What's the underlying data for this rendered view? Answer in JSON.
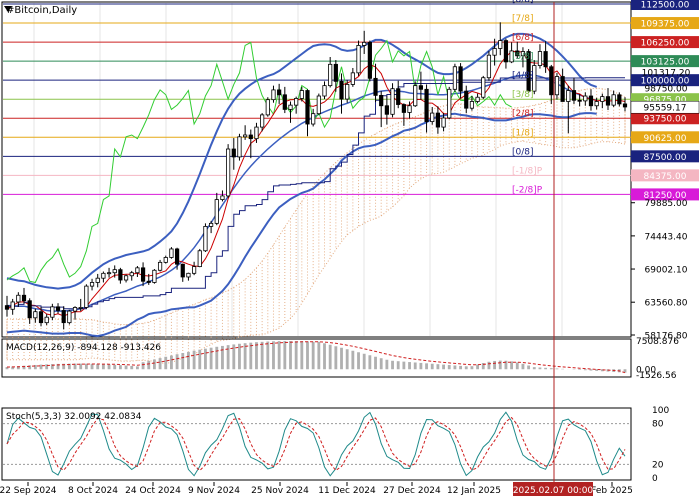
{
  "window": {
    "symbol_label": "#Bitcoin,Daily",
    "macd_label": "MACD(12,26,9) -894.128 -913.426",
    "stoch_label": "Stoch(5,3,3) 32.0092 42.0834",
    "crosshair_date": "2025.02.07 00:00"
  },
  "colors": {
    "bg": "#ffffff",
    "grid": "#e6e6e6",
    "candle": "#000000",
    "bollinger": "#3c5fc0",
    "green_line": "#32cd32",
    "red_line": "#cc0000",
    "navy_line": "#1a237e",
    "cloud": "#e0a070",
    "vertical_line": "#b22222",
    "macd_hist": "#b0b0b0",
    "macd_signal": "#d02020",
    "stoch_main": "#1f8a8a",
    "stoch_signal": "#d02020"
  },
  "chart_data": [
    {
      "type": "candlestick",
      "symbol": "#Bitcoin",
      "timeframe": "Daily",
      "x_labels": [
        "22 Sep 2024",
        "8 Oct 2024",
        "24 Oct 2024",
        "9 Nov 2024",
        "25 Nov 2024",
        "11 Dec 2024",
        "27 Dec 2024",
        "12 Jan 2025",
        "Feb 2025"
      ],
      "ylim": [
        58176.8,
        112500
      ],
      "price_ticks": [
        "58176.80",
        "63560.80",
        "69002.10",
        "74443.40",
        "79885.00"
      ],
      "current_price": "95559.17",
      "murray_levels": [
        {
          "label": "[8/8]",
          "price": "112500.00",
          "color": "#1a237e",
          "box": true
        },
        {
          "label": "[7/8]",
          "price": "109375.00",
          "color": "#e6a817",
          "box": true
        },
        {
          "label": "[6/8]",
          "price": "106250.00",
          "color": "#cc2222",
          "box": true
        },
        {
          "label": "[5/8]",
          "price": "103125.00",
          "color": "#2e8b57",
          "box": true
        },
        {
          "label": "[4/8]",
          "price": "100000.00",
          "color": "#1a237e",
          "box": true
        },
        {
          "label": "[3/8]",
          "price": "96875.00",
          "color": "#8bc34a",
          "box": true
        },
        {
          "label": "[2/8]",
          "price": "93750.00",
          "color": "#cc2222",
          "box": true
        },
        {
          "label": "[1/8]",
          "price": "90625.00",
          "color": "#e6a817",
          "box": true
        },
        {
          "label": "[0/8]",
          "price": "87500.00",
          "color": "#1a237e",
          "box": true
        },
        {
          "label": "[-1/8]P",
          "price": "84375.00",
          "color": "#f4b6c2",
          "box": true
        },
        {
          "label": "[-2/8]P",
          "price": "81250.00",
          "color": "#d81bd8",
          "box": true
        }
      ],
      "price_labels_plain": [
        "101317.20",
        "98750.00"
      ],
      "ohlc": [
        [
          63000,
          64600,
          61200,
          62400
        ],
        [
          62400,
          64100,
          61500,
          63600
        ],
        [
          63600,
          65200,
          62800,
          64700
        ],
        [
          64700,
          65900,
          63300,
          63800
        ],
        [
          63800,
          64200,
          60000,
          61000
        ],
        [
          61000,
          62500,
          60200,
          62000
        ],
        [
          62000,
          62800,
          59600,
          60200
        ],
        [
          60200,
          61600,
          59800,
          61100
        ],
        [
          61100,
          63300,
          60600,
          62800
        ],
        [
          62800,
          63400,
          61700,
          62200
        ],
        [
          62200,
          62900,
          59100,
          60200
        ],
        [
          60200,
          62300,
          59900,
          62100
        ],
        [
          62100,
          62900,
          60700,
          62700
        ],
        [
          62700,
          64100,
          62100,
          62700
        ],
        [
          62700,
          66500,
          62500,
          66200
        ],
        [
          66200,
          67400,
          65500,
          66800
        ],
        [
          66800,
          68200,
          66000,
          67500
        ],
        [
          67500,
          68600,
          66800,
          68300
        ],
        [
          68300,
          69200,
          67600,
          68400
        ],
        [
          68400,
          69600,
          67600,
          68900
        ],
        [
          68900,
          69200,
          66600,
          67200
        ],
        [
          67200,
          68100,
          66800,
          67900
        ],
        [
          67900,
          68700,
          67100,
          68400
        ],
        [
          68400,
          69500,
          67700,
          69200
        ],
        [
          69200,
          70100,
          66200,
          67000
        ],
        [
          67000,
          68200,
          66400,
          66800
        ],
        [
          66800,
          69000,
          66600,
          68800
        ],
        [
          68800,
          70500,
          68600,
          70100
        ],
        [
          70100,
          71200,
          69900,
          70900
        ],
        [
          70900,
          72600,
          70700,
          72300
        ],
        [
          72300,
          72500,
          68900,
          69800
        ],
        [
          69800,
          69900,
          66900,
          67700
        ],
        [
          67700,
          68400,
          67100,
          68300
        ],
        [
          68300,
          70200,
          68000,
          69400
        ],
        [
          69400,
          72300,
          69300,
          72000
        ],
        [
          72000,
          76500,
          71800,
          76000
        ],
        [
          76000,
          76900,
          74900,
          76500
        ],
        [
          76500,
          81500,
          76200,
          80400
        ],
        [
          80400,
          81900,
          80100,
          81000
        ],
        [
          81000,
          89500,
          80700,
          88700
        ],
        [
          88700,
          90500,
          85300,
          87400
        ],
        [
          87400,
          91200,
          86800,
          90700
        ],
        [
          90700,
          92600,
          90200,
          91000
        ],
        [
          91000,
          91900,
          87200,
          90400
        ],
        [
          90400,
          93000,
          89700,
          92300
        ],
        [
          92300,
          94600,
          91600,
          94300
        ],
        [
          94300,
          97200,
          94000,
          96800
        ],
        [
          96800,
          99100,
          96300,
          98400
        ],
        [
          98400,
          99400,
          96100,
          97600
        ],
        [
          97600,
          98900,
          94600,
          95200
        ],
        [
          95200,
          96500,
          93000,
          95900
        ],
        [
          95900,
          97300,
          94500,
          97000
        ],
        [
          97000,
          98900,
          96500,
          98300
        ],
        [
          98300,
          98500,
          90800,
          92800
        ],
        [
          92800,
          95300,
          92400,
          94500
        ],
        [
          94500,
          97800,
          94300,
          97400
        ],
        [
          97400,
          99800,
          96900,
          99100
        ],
        [
          99100,
          103800,
          98800,
          102600
        ],
        [
          102600,
          103300,
          98100,
          99800
        ],
        [
          99800,
          101100,
          94500,
          96900
        ],
        [
          96900,
          100000,
          96300,
          99300
        ],
        [
          99300,
          102000,
          98900,
          101200
        ],
        [
          101200,
          106500,
          100700,
          105700
        ],
        [
          105700,
          108100,
          104300,
          106200
        ],
        [
          106200,
          106500,
          99800,
          100300
        ],
        [
          100300,
          102700,
          96400,
          97500
        ],
        [
          97500,
          98200,
          92300,
          95800
        ],
        [
          95800,
          97400,
          92700,
          94400
        ],
        [
          94400,
          99500,
          93900,
          98600
        ],
        [
          98600,
          99900,
          95400,
          96000
        ],
        [
          96000,
          96200,
          92500,
          94700
        ],
        [
          94700,
          96500,
          93700,
          95800
        ],
        [
          95800,
          99800,
          95600,
          99100
        ],
        [
          99100,
          101400,
          96800,
          98500
        ],
        [
          98500,
          99300,
          91400,
          93200
        ],
        [
          93200,
          95600,
          92700,
          94600
        ],
        [
          94600,
          95700,
          91200,
          92300
        ],
        [
          92300,
          94600,
          91600,
          93800
        ],
        [
          93800,
          98900,
          93600,
          98500
        ],
        [
          98500,
          102700,
          98100,
          102200
        ],
        [
          102200,
          102800,
          97000,
          98200
        ],
        [
          98200,
          99100,
          94600,
          95400
        ],
        [
          95400,
          97400,
          95000,
          96500
        ],
        [
          96500,
          97800,
          96200,
          97200
        ],
        [
          97200,
          100700,
          96900,
          100400
        ],
        [
          100400,
          104800,
          99900,
          104100
        ],
        [
          104100,
          106800,
          102400,
          105200
        ],
        [
          105200,
          109500,
          104100,
          106500
        ],
        [
          106500,
          106800,
          101900,
          103000
        ],
        [
          103000,
          106200,
          102800,
          104800
        ],
        [
          104800,
          106300,
          103600,
          104000
        ],
        [
          104000,
          105400,
          102100,
          104700
        ],
        [
          104700,
          105100,
          97900,
          98200
        ],
        [
          98200,
          103300,
          97700,
          102400
        ],
        [
          102400,
          105900,
          101900,
          104700
        ],
        [
          104700,
          106400,
          101200,
          102200
        ],
        [
          102200,
          102500,
          96100,
          97600
        ],
        [
          97600,
          101200,
          96800,
          100600
        ],
        [
          100600,
          101900,
          98700,
          96500
        ],
        [
          96500,
          99100,
          91300,
          98300
        ],
        [
          98300,
          100400,
          96100,
          96700
        ],
        [
          96700,
          97700,
          95700,
          96600
        ],
        [
          96600,
          98000,
          95800,
          97400
        ],
        [
          97400,
          98500,
          95000,
          95800
        ],
        [
          95800,
          97100,
          95200,
          96500
        ],
        [
          96500,
          97800,
          95400,
          97300
        ],
        [
          97300,
          98700,
          95100,
          95900
        ],
        [
          95900,
          98300,
          95600,
          97600
        ],
        [
          97600,
          98000,
          95700,
          96100
        ],
        [
          96100,
          97200,
          94900,
          95600
        ]
      ],
      "bollinger_upper": [
        67500,
        67300,
        67100,
        67000,
        66700,
        66400,
        66200,
        66000,
        65900,
        65800,
        65900,
        66000,
        66300,
        66800,
        67600,
        68400,
        69100,
        69800,
        70300,
        70700,
        71000,
        71300,
        71500,
        71700,
        71900,
        72200,
        72800,
        73500,
        74300,
        75200,
        76500,
        78200,
        80100,
        82300,
        84600,
        87000,
        89400,
        91600,
        93600,
        95300,
        96700,
        97800,
        98600,
        99300,
        99900,
        100300,
        100700,
        101000,
        101500,
        102200,
        102900,
        103600,
        104300,
        105000,
        105600,
        105800,
        105900,
        105800,
        105500,
        105000,
        104800,
        104900,
        105200,
        105700,
        106200,
        106600,
        106600,
        106300,
        105800,
        105200,
        104500,
        103900,
        103400,
        102900,
        102300,
        101700,
        101200,
        101000,
        101000,
        101100,
        101500,
        102000,
        102600,
        103300,
        104000,
        104800,
        105600,
        106400,
        107000,
        107400,
        107600,
        107600,
        107500,
        107200,
        106800,
        106300,
        105600,
        104800,
        103900,
        102900,
        101800,
        100700,
        99800,
        99200,
        98900
      ],
      "bollinger_middle": [
        63000,
        63000,
        62900,
        62900,
        62700,
        62500,
        62400,
        62200,
        62100,
        62100,
        62100,
        62200,
        62300,
        62500,
        62800,
        63200,
        63600,
        64000,
        64400,
        64800,
        65100,
        65400,
        65800,
        66200,
        66500,
        66900,
        67300,
        67700,
        68200,
        68800,
        69500,
        70400,
        71400,
        72500,
        73800,
        75200,
        76600,
        78100,
        79500,
        80900,
        82300,
        83600,
        84800,
        85900,
        86900,
        87800,
        88700,
        89500,
        90300,
        91000,
        91700,
        92300,
        92900,
        93400,
        93900,
        94400,
        94800,
        95200,
        95500,
        95900,
        96200,
        96600,
        97000,
        97400,
        97700,
        98000,
        98200,
        98300,
        98300,
        98200,
        98100,
        97900,
        97800,
        97800,
        97700,
        97700,
        97600,
        97600,
        97700,
        97800,
        97900,
        98100,
        98300,
        98600,
        98900,
        99200,
        99500,
        99900,
        100200,
        100500,
        100700,
        100800,
        100900,
        100800,
        100600,
        100300,
        99900,
        99400,
        98900,
        98400,
        98000,
        97600,
        97200,
        96900,
        96700
      ],
      "bollinger_lower": [
        58600,
        58700,
        58800,
        58900,
        58800,
        58700,
        58600,
        58500,
        58400,
        58400,
        58400,
        58500,
        58500,
        58500,
        58300,
        58100,
        58000,
        58200,
        58500,
        58900,
        59200,
        59500,
        60100,
        60700,
        61100,
        61600,
        61800,
        61900,
        62100,
        62400,
        62500,
        62600,
        62700,
        62700,
        63000,
        63400,
        63800,
        64600,
        65400,
        66500,
        67900,
        69400,
        71000,
        72500,
        73900,
        75300,
        76700,
        78000,
        79100,
        79800,
        80500,
        81000,
        81500,
        81800,
        82200,
        83000,
        83700,
        84600,
        85500,
        86800,
        87600,
        88300,
        88800,
        89100,
        89200,
        89400,
        89800,
        90300,
        90800,
        91200,
        91700,
        91900,
        92200,
        92700,
        93100,
        93700,
        94000,
        94200,
        94400,
        94500,
        94300,
        94200,
        94000,
        93900,
        93800,
        93600,
        93400,
        93400,
        93400,
        93600,
        93800,
        94000,
        94300,
        94400,
        94400,
        94300,
        94200,
        94000,
        93900,
        93900,
        94200,
        94500,
        94600,
        94600,
        94500
      ]
    },
    {
      "type": "macd",
      "label": "MACD(12,26,9)",
      "values": [
        -894.128,
        -913.426
      ],
      "tick_labels": [
        "7508.876",
        "0.00",
        "-1526.56"
      ],
      "ylim": [
        -1526.56,
        7508.876
      ]
    },
    {
      "type": "stochastic",
      "label": "Stoch(5,3,3)",
      "values": [
        32.0092,
        42.0834
      ],
      "tick_labels": [
        "100",
        "80",
        "20",
        "0"
      ],
      "ylim": [
        0,
        100
      ]
    }
  ]
}
